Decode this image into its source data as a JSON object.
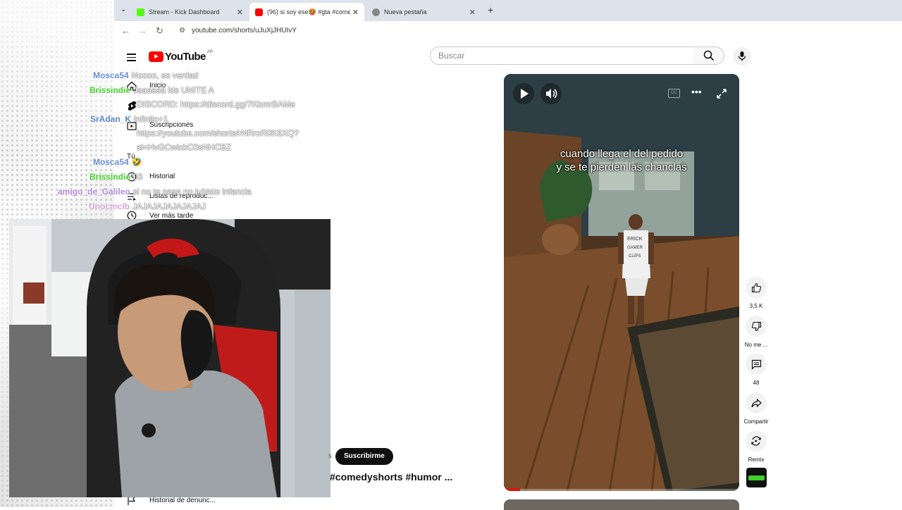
{
  "browser": {
    "tabs": [
      {
        "title": "Stream - Kick Dashboard",
        "active": false,
        "favicon_color": "#53fc18"
      },
      {
        "title": "(96) si soy ese🥵 #gta #comed",
        "active": true,
        "favicon_color": "#ff0000"
      },
      {
        "title": "Nueva pestaña",
        "active": false,
        "favicon_color": "#888888"
      }
    ],
    "url": "youtube.com/shorts/uJuXjJHUIvY"
  },
  "youtube": {
    "logo_text": "YouTube",
    "country": "AR",
    "search_placeholder": "Buscar",
    "sidebar": {
      "inicio": "Inicio",
      "suscripciones": "Suscripciones",
      "tu": "Tú",
      "historial": "Historial",
      "listas": "Listas de reproduc...",
      "ver_mas_tarde": "Ver más tarde",
      "historial_denuncias": "Historial de denunc..."
    },
    "video": {
      "caption_line1": "cuando llega el del pedido",
      "caption_line2": "y se te pierden las chanclas",
      "shirt_text": "ERICK GAMER CLIPS",
      "progress_pct": 7
    },
    "actions": {
      "likes": "3,5 K",
      "dislike": "No me ...",
      "comments": "48",
      "share": "Compartir",
      "remix": "Remix"
    },
    "subscribe": "Suscribirme",
    "title": "#comedyshorts #humor ...",
    "title_prefix_fragment": "s"
  },
  "chat": [
    {
      "user": "Mosca54",
      "color": "#6b8fd6",
      "msg": "Noooo, es verdad"
    },
    {
      "user": "Brissindie",
      "color": "#41d12a",
      "msg": "Jaaaaaa lds UNITE A"
    },
    {
      "user": "",
      "color": "#ffffff",
      "msg": "DISCORD: https://discord.gg/7KbmrBAMe"
    },
    {
      "user": "SrAdan_K",
      "color": "#5b86c7",
      "msg": "infinito+1"
    },
    {
      "user": "",
      "color": "#ffffff",
      "msg": "https://youtube.com/shorts/rNRroR0K6XQ?"
    },
    {
      "user": "",
      "color": "#ffffff",
      "msg": "si=HvGCwixkC0sNHCBZ"
    },
    {
      "user": "Mosca54",
      "color": "#6b8fd6",
      "msg": "🤣"
    },
    {
      "user": "Brissindie",
      "color": "#41d12a",
      "msg": "03"
    },
    {
      "user": "amigo_de_Galileo",
      "color": "#b58ad8",
      "msg": "si no te pasa no tubiste infancia"
    },
    {
      "user": "Unocmclb",
      "color": "#d6a6d6",
      "msg": "JAJAJAJAJAJAJAJ"
    }
  ]
}
